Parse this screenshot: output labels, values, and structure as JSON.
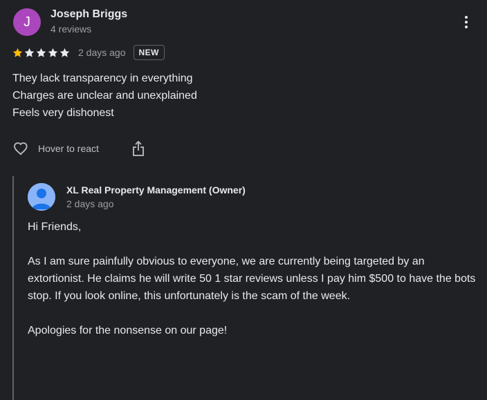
{
  "review": {
    "reviewer": {
      "initial": "J",
      "name": "Joseph Briggs",
      "meta": "4 reviews",
      "avatar_color": "#ab47bc"
    },
    "rating": {
      "value": 1,
      "max": 5,
      "filled_color": "#fbbc04",
      "empty_color": "#e8eaed"
    },
    "date": "2 days ago",
    "badge": "NEW",
    "text_lines": [
      "They lack transparency in everything",
      "Charges are unclear and unexplained",
      "Feels very dishonest"
    ],
    "actions": {
      "react_label": "Hover to react",
      "react_icon": "heart-outline-icon",
      "share_icon": "share-icon",
      "more_icon": "more-vert-icon"
    }
  },
  "owner_reply": {
    "name": "XL Real Property Management (Owner)",
    "date": "2 days ago",
    "avatar_icon": "default-person-icon",
    "paragraphs": [
      "Hi Friends,",
      "As I am sure painfully obvious to everyone, we are currently being targeted by an extortionist. He claims he will write 50 1 star reviews unless I pay him $500 to have the bots stop. If you look online, this unfortunately is the scam of the week.",
      "Apologies for the nonsense on our page!"
    ]
  },
  "colors": {
    "background": "#202124",
    "text": "#e8eaed",
    "muted": "#9aa0a6",
    "accent_star": "#fbbc04"
  }
}
